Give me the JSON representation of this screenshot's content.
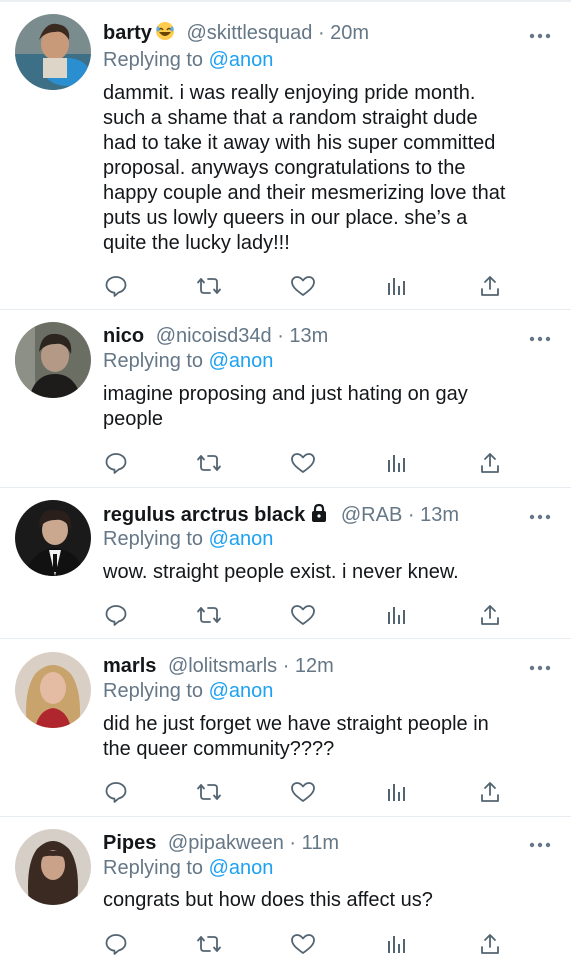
{
  "replies": [
    {
      "name": "barty",
      "emoji": "😂",
      "handle": "@skittlesquad",
      "time": "· 20m",
      "replying_prefix": "Replying to",
      "replying_to": "@anon",
      "text": "dammit. i was really enjoying pride month.\nsuch a shame that a random straight dude\nhad to take it away with his super committed\nproposal. anyways congratulations to the\nhappy couple and their mesmerizing love that\nputs us lowly queers in our place. she’s a\nquite the lucky lady!!!",
      "avatar_icon": "avatar-photo"
    },
    {
      "name": "nico",
      "handle": "@nicoisd34d",
      "time": "· 13m",
      "replying_prefix": "Replying to",
      "replying_to": "@anon",
      "text": "imagine proposing and just hating on gay\npeople",
      "avatar_icon": "avatar-photo"
    },
    {
      "name": "regulus arctrus black",
      "lock_icon": "lock-icon",
      "handle": "@RAB",
      "time": "· 13m",
      "replying_prefix": "Replying to",
      "replying_to": "@anon",
      "text": "wow. straight people exist. i never knew.",
      "avatar_icon": "avatar-photo"
    },
    {
      "name": "marls",
      "handle": "@lolitsmarls",
      "time": "· 12m",
      "replying_prefix": "Replying to",
      "replying_to": "@anon",
      "text": "did he just forget we have straight people in\nthe queer community????",
      "avatar_icon": "avatar-photo"
    },
    {
      "name": "Pipes",
      "handle": "@pipakween",
      "time": "· 11m",
      "replying_prefix": "Replying to",
      "replying_to": "@anon",
      "text": "congrats but how does this affect us?",
      "avatar_icon": "avatar-photo"
    }
  ],
  "action_icons": [
    "reply-icon",
    "retweet-icon",
    "like-icon",
    "analytics-icon",
    "share-icon"
  ],
  "colors": {
    "link": "#1da1f2",
    "secondary_text": "#657786",
    "primary_text": "#14171a",
    "divider": "#e6ecf0"
  }
}
